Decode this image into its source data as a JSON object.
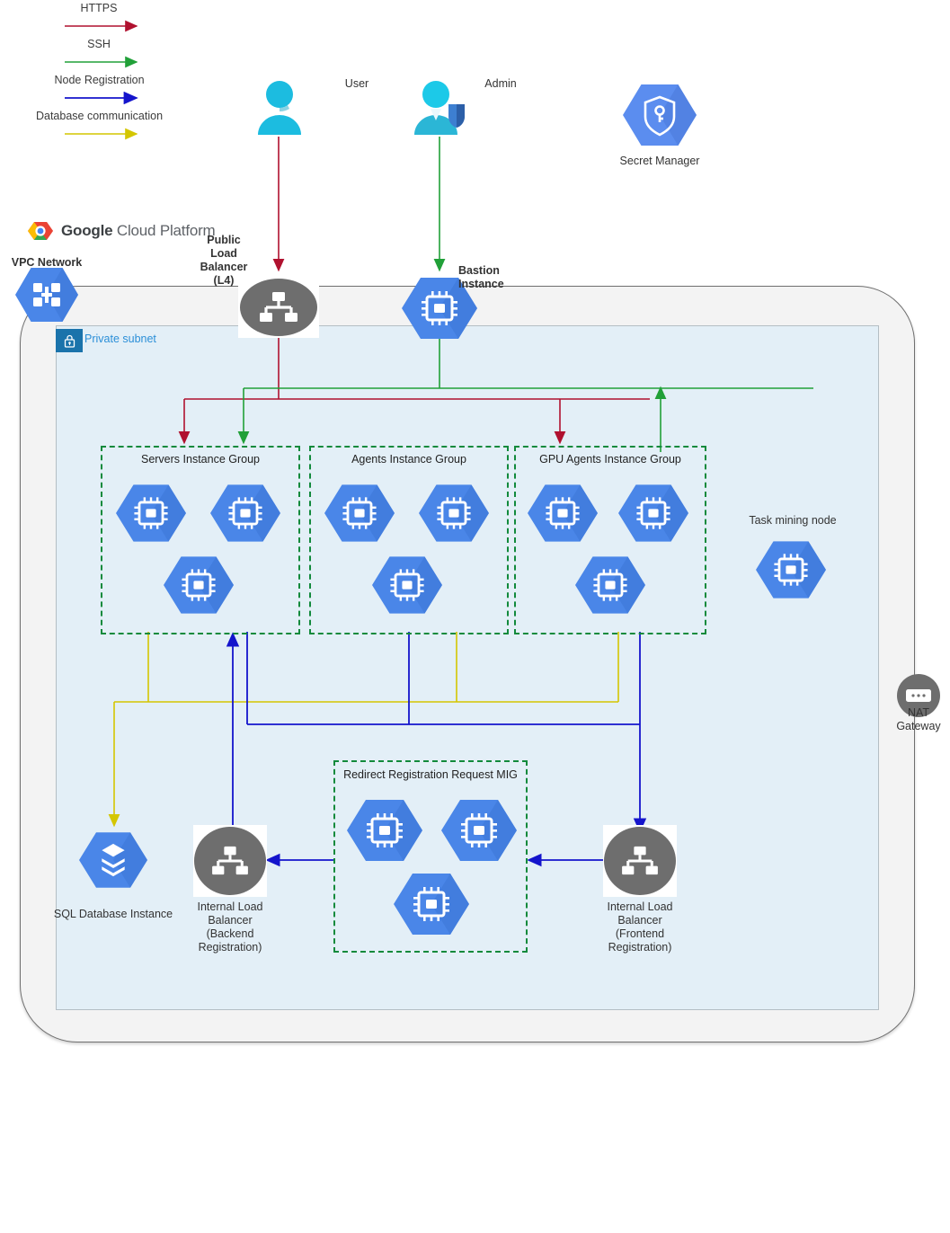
{
  "legend": {
    "items": [
      {
        "label": "HTTPS",
        "color": "#b0112f",
        "icon": "arrow-right-icon"
      },
      {
        "label": "SSH",
        "color": "#21a038",
        "icon": "arrow-right-icon"
      },
      {
        "label": "Node Registration",
        "color": "#1414cc",
        "icon": "arrow-right-icon"
      },
      {
        "label": "Database communication",
        "color": "#d4c600",
        "icon": "arrow-right-icon"
      }
    ]
  },
  "branding": {
    "google_bold": "Google",
    "google_rest": " Cloud Platform"
  },
  "vpc": {
    "label": "VPC Network",
    "subnet_label": "Private subnet"
  },
  "actors": {
    "user": "User",
    "admin": "Admin"
  },
  "nodes": {
    "secret_manager": "Secret Manager",
    "public_lb": "Public\nLoad\nBalancer\n(L4)",
    "bastion": "Bastion\nInstance",
    "task_mining": "Task mining node",
    "nat_gateway": "NAT\nGateway",
    "sql_db": "SQL Database Instance",
    "ilb_backend": "Internal Load\nBalancer\n(Backend\nRegistration)",
    "ilb_frontend": "Internal Load\nBalancer\n(Frontend\nRegistration)"
  },
  "groups": {
    "servers": {
      "title": "Servers Instance Group",
      "instances": 3
    },
    "agents": {
      "title": "Agents Instance Group",
      "instances": 3
    },
    "gpu_agents": {
      "title": "GPU Agents Instance Group",
      "instances": 3
    },
    "redirect_mig": {
      "title": "Redirect Registration Request MIG",
      "instances": 3
    }
  },
  "colors": {
    "https": "#b0112f",
    "ssh": "#21a038",
    "node_registration": "#1414cc",
    "database": "#d4c600",
    "gcp_blue": "#4a86e8",
    "grey_node": "#6e6e6e",
    "group_dash": "#128a3c",
    "subnet_fill": "#e3eff7",
    "vpc_fill": "#f3f3f3"
  }
}
